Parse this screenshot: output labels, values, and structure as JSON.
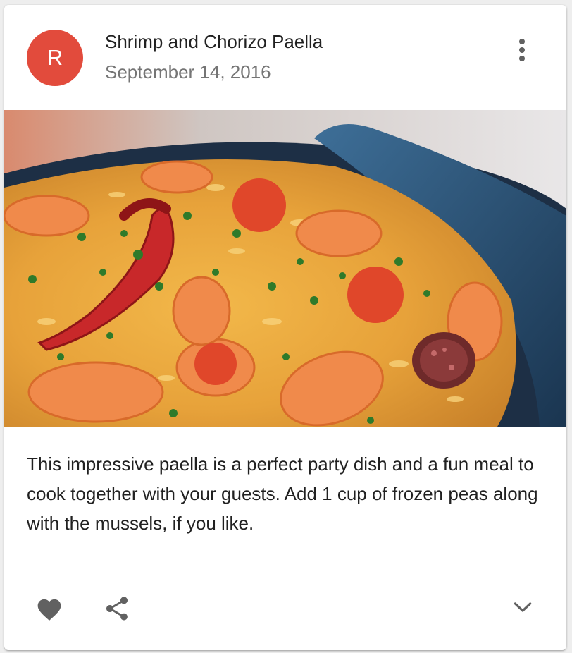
{
  "card": {
    "avatar": {
      "letter": "R",
      "color": "#e24b3c"
    },
    "title": "Shrimp and Chorizo Paella",
    "subheader": "September 14, 2016",
    "menu_icon": "more-vert-icon",
    "image": {
      "subject": "paella-dish"
    },
    "body": "This impressive paella is a perfect party dish and a fun meal to cook together with your guests. Add 1 cup of frozen peas along with the mussels, if you like.",
    "actions": {
      "favorite_icon": "heart-icon",
      "share_icon": "share-icon",
      "expand_icon": "chevron-down-icon",
      "icon_color": "#616161"
    }
  }
}
